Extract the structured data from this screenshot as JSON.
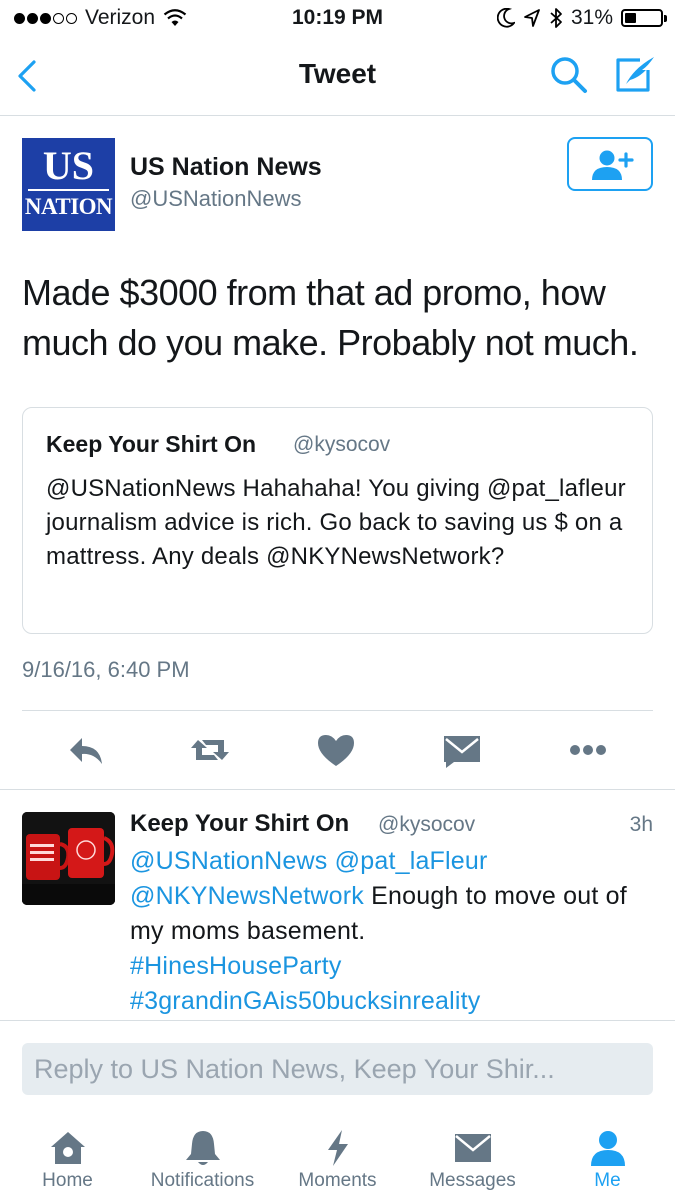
{
  "status_bar": {
    "carrier": "Verizon",
    "time": "10:19 PM",
    "battery": "31%",
    "battery_level": 0.31,
    "signal_bars": 3,
    "signal_total": 5
  },
  "nav": {
    "title": "Tweet",
    "back_icon": "chevron-left-icon",
    "search_icon": "search-icon",
    "compose_icon": "compose-icon"
  },
  "author": {
    "avatar_line1": "US",
    "avatar_line2": "NATION",
    "name": "US Nation News",
    "handle": "@USNationNews"
  },
  "tweet": {
    "text": "Made $3000 from that ad promo, how much do you make. Probably not much.",
    "timestamp": "9/16/16, 6:40 PM"
  },
  "quoted": {
    "name": "Keep Your Shirt On",
    "handle": "@kysocov",
    "text": "@USNationNews Hahahaha! You giving @pat_lafleur journalism advice is rich. Go back to saving us $ on a mattress. Any deals @NKYNewsNetwork?"
  },
  "actions": [
    "reply-icon",
    "retweet-icon",
    "like-icon",
    "dm-icon",
    "more-icon"
  ],
  "reply": {
    "name": "Keep Your Shirt On",
    "handle": "@kysocov",
    "time": "3h",
    "mention1": "@USNationNews",
    "mention2": "@pat_laFleur",
    "mention3": "@NKYNewsNetwork",
    "body": " Enough to move out of my moms basement.",
    "hashtag1": "#HinesHouseParty",
    "hashtag2": "#3grandinGAis50bucksinreality"
  },
  "composer": {
    "placeholder": "Reply to US Nation News, Keep Your Shir..."
  },
  "tabs": [
    {
      "label": "Home",
      "icon": "home-icon"
    },
    {
      "label": "Notifications",
      "icon": "bell-icon"
    },
    {
      "label": "Moments",
      "icon": "lightning-icon"
    },
    {
      "label": "Messages",
      "icon": "envelope-icon"
    },
    {
      "label": "Me",
      "icon": "person-icon"
    }
  ],
  "colors": {
    "accent": "#1da1f2",
    "link": "#1b95e0",
    "secondary_text": "#657786",
    "icon_gray": "#657786",
    "avatar_blue": "#1d3fa6"
  }
}
